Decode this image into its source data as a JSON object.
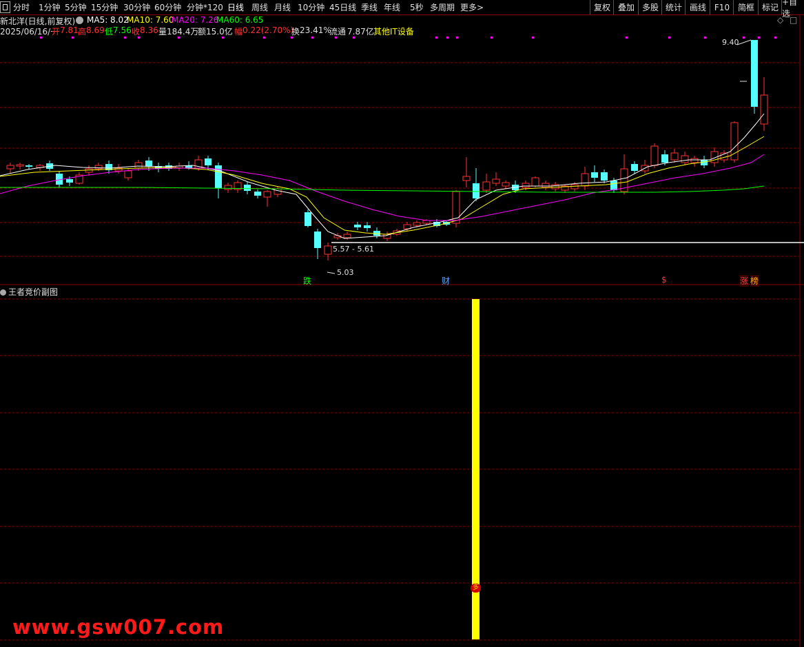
{
  "toolbar": {
    "periods": [
      "分时",
      "1分钟",
      "5分钟",
      "15分钟",
      "30分钟",
      "60分钟",
      "分钟*120",
      "日线",
      "周线",
      "月线",
      "10分钟",
      "45日线",
      "季线",
      "年线",
      "5秒",
      "多周期",
      "更多>"
    ],
    "active_period": "日线",
    "right_buttons": [
      "复权",
      "叠加",
      "多股",
      "统计",
      "画线",
      "F10",
      "简框",
      "标记",
      "+自选"
    ]
  },
  "stock": {
    "name": "新北洋",
    "mode": "(日线,前复权)",
    "ma5": "MA5: 8.02",
    "ma10": "MA10: 7.60",
    "ma20": "MA20: 7.26",
    "ma60": "MA60: 6.65"
  },
  "quote": {
    "date": "2025/06/16/一",
    "open_label": "开",
    "open": "7.81",
    "high_label": "高",
    "high": "8.69",
    "low_label": "低",
    "low": "7.56",
    "close_label": "收",
    "close": "8.36",
    "vol_label": "量",
    "vol": "184.4万",
    "amt_label": "额",
    "amt": "15.0亿",
    "chg_label": "幅",
    "chg": "0.22(2.70%)",
    "turn_label": "换",
    "turn": "23.41%",
    "float_label": "流通",
    "float": "7.87亿",
    "sector": "其他IT设备"
  },
  "annotations": {
    "high_price": "9.40",
    "low_price": "5.03",
    "range": "5.57 - 5.61",
    "sig_die": "跌",
    "sig_cai": "财",
    "sig_s": "$",
    "sig_zhang": "涨",
    "sig_bang": "榜",
    "sub_marker": "多"
  },
  "sub_chart": {
    "title": "王者竞价副图"
  },
  "watermark": "www.gsw007.com",
  "colors": {
    "up": "#ff3232",
    "down": "#54ffff",
    "ma5": "#ffffff",
    "ma10": "#ffff00",
    "ma20": "#ff00ff",
    "ma60": "#00ff00",
    "grid": "#8b0000",
    "signal": "#ffff00"
  }
}
